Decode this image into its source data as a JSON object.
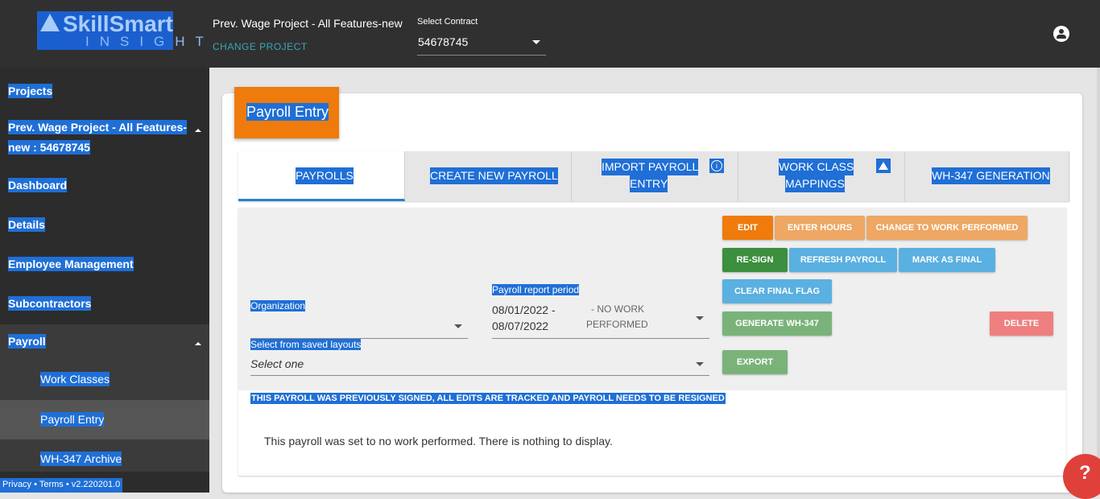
{
  "header": {
    "logo_line1": "SkillSmart",
    "logo_line2": "INSIGHT",
    "project_name": "Prev. Wage Project - All Features-new",
    "change_project": "CHANGE PROJECT",
    "contract_label": "Select Contract",
    "contract_value": "54678745"
  },
  "sidebar": {
    "items": [
      {
        "label": "Projects"
      },
      {
        "label": "Prev. Wage Project - All Features-",
        "label2": "new : 54678745"
      },
      {
        "label": "Dashboard"
      },
      {
        "label": "Details"
      },
      {
        "label": "Employee Management"
      },
      {
        "label": "Subcontractors"
      },
      {
        "label": "Payroll"
      },
      {
        "label": "Work Classes"
      },
      {
        "label": "Payroll Entry"
      },
      {
        "label": "WH-347 Archive"
      }
    ],
    "footer": "Privacy • Terms • v2.220201.0"
  },
  "page": {
    "title": "Payroll Entry"
  },
  "tabs": [
    {
      "label": "PAYROLLS"
    },
    {
      "label": "CREATE NEW PAYROLL"
    },
    {
      "label": "IMPORT PAYROLL",
      "label2": "ENTRY"
    },
    {
      "label": "WORK CLASS",
      "label2": "MAPPINGS"
    },
    {
      "label": "WH-347 GENERATION"
    }
  ],
  "form": {
    "organization_label": "Organization",
    "period_label": "Payroll report period",
    "period_date1": "08/01/2022 -",
    "period_date2": "08/07/2022",
    "period_note1": "- NO WORK",
    "period_note2": "PERFORMED",
    "layouts_label": "Select from saved layouts",
    "layouts_value": "Select one"
  },
  "buttons": {
    "edit": "EDIT",
    "enter_hours": "ENTER HOURS",
    "change_work": "CHANGE TO WORK PERFORMED",
    "resign": "RE-SIGN",
    "refresh": "REFRESH PAYROLL",
    "mark_final": "MARK AS FINAL",
    "clear_final": "CLEAR FINAL FLAG",
    "generate": "GENERATE WH-347",
    "delete": "DELETE",
    "export": "EXPORT"
  },
  "messages": {
    "warning": "THIS PAYROLL WAS PREVIOUSLY SIGNED, ALL EDITS ARE TRACKED AND PAYROLL NEEDS TO BE RESIGNED",
    "no_work": "This payroll was set to no work performed. There is nothing to display."
  },
  "help": {
    "label": "?"
  },
  "colors": {
    "header_bg": "#303030",
    "sidebar_bg": "#2c2c2c",
    "accent_orange": "#ef7b0c",
    "selection_blue": "#1f6fd6",
    "tab_active_border": "#2a7fd0",
    "green": "#3b8f3e",
    "light_green": "#7ab37a",
    "light_blue": "#5ab0e0",
    "light_orange": "#eea764",
    "red_light": "#ef7f7f",
    "help_red": "#e0403a"
  }
}
